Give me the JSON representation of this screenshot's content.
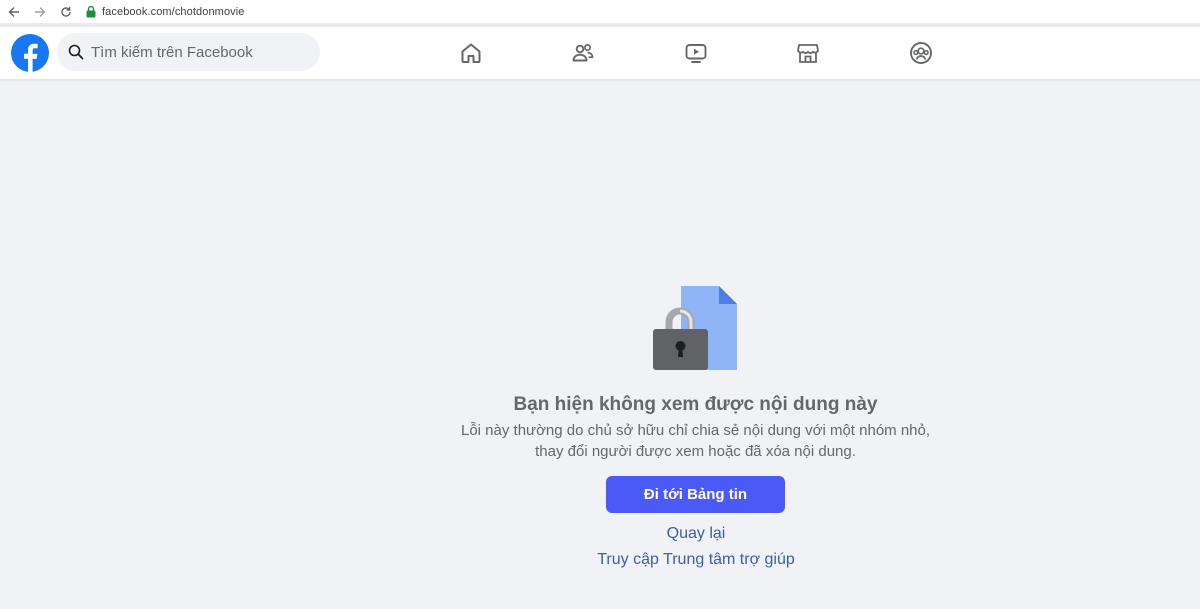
{
  "browser": {
    "url": "facebook.com/chotdonmovie",
    "icons": [
      "back-arrow-icon",
      "forward-arrow-icon",
      "reload-icon",
      "secure-lock-icon"
    ]
  },
  "header": {
    "logo": "facebook-logo-icon",
    "search_placeholder": "Tìm kiếm trên Facebook",
    "nav_icons": [
      "home-icon",
      "friends-icon",
      "watch-video-icon",
      "marketplace-icon",
      "groups-icon"
    ]
  },
  "main": {
    "illustration": "locked-document-icon",
    "title": "Bạn hiện không xem được nội dung này",
    "description": "Lỗi này thường do chủ sở hữu chỉ chia sẻ nội dung với một nhóm nhỏ, thay đổi người được xem hoặc đã xóa nội dung.",
    "primary_button": "Đi tới Bảng tin",
    "back_link": "Quay lại",
    "help_link": "Truy cập Trung tâm trợ giúp"
  },
  "colors": {
    "page_bg": "#f0f2f5",
    "facebook_blue": "#1877f2",
    "button_bg": "#4b59f7",
    "link_blue": "#3b5ea8",
    "secondary_text": "#65676b",
    "nav_icon": "#65676b"
  }
}
